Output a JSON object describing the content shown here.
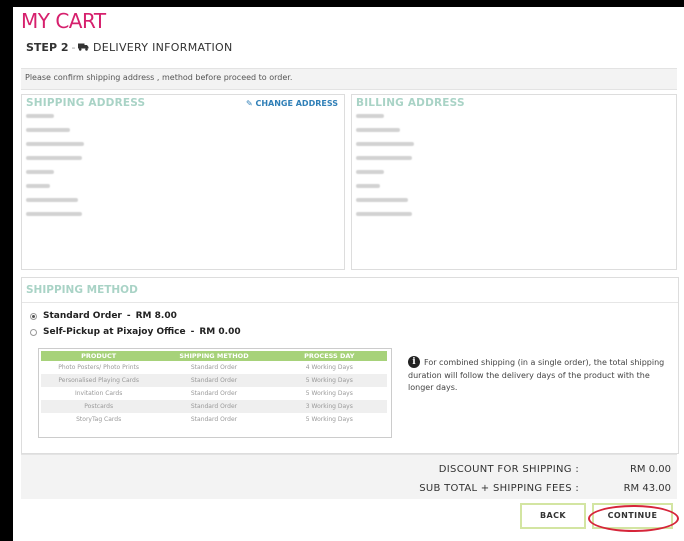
{
  "page": {
    "title": "MY CART",
    "step_label": "STEP 2",
    "step_separator": "-",
    "step_title": "DELIVERY INFORMATION",
    "step_icon": "truck-icon",
    "confirm_text": "Please confirm shipping address , method before proceed to order."
  },
  "shipping_address": {
    "heading": "SHIPPING ADDRESS",
    "change_label": "CHANGE ADDRESS",
    "change_icon": "edit-icon"
  },
  "billing_address": {
    "heading": "BILLING ADDRESS"
  },
  "shipping_method": {
    "heading": "SHIPPING METHOD",
    "options": [
      {
        "label": "Standard Order",
        "price": "RM 8.00",
        "selected": true
      },
      {
        "label": "Self-Pickup at Pixajoy Office",
        "price": "RM 0.00",
        "selected": false
      }
    ],
    "price_separator": "-",
    "table": {
      "headers": [
        "PRODUCT",
        "SHIPPING METHOD",
        "PROCESS DAY"
      ],
      "rows": [
        [
          "Photo Posters/ Photo Prints",
          "Standard Order",
          "4 Working Days"
        ],
        [
          "Personalised Playing Cards",
          "Standard Order",
          "5 Working Days"
        ],
        [
          "Invitation Cards",
          "Standard Order",
          "5 Working Days"
        ],
        [
          "Postcards",
          "Standard Order",
          "3 Working Days"
        ],
        [
          "StoryTag Cards",
          "Standard Order",
          "5 Working Days"
        ]
      ]
    },
    "info_icon": "info-icon",
    "info_text": "For combined shipping (in a single order), the total shipping duration will follow the delivery days of the product with the longer days."
  },
  "summary": {
    "discount_label": "DISCOUNT FOR SHIPPING :",
    "discount_value": "RM 0.00",
    "subtotal_label": "SUB TOTAL + SHIPPING FEES :",
    "subtotal_value": "RM 43.00"
  },
  "buttons": {
    "back": "BACK",
    "continue": "CONTINUE"
  },
  "colors": {
    "title": "#d6206d",
    "heading": "#a9d3c6",
    "link": "#2f7fb7",
    "table_header": "#a7d27a",
    "button_border": "#d3e5a2",
    "highlight_ring": "#d6253a"
  }
}
